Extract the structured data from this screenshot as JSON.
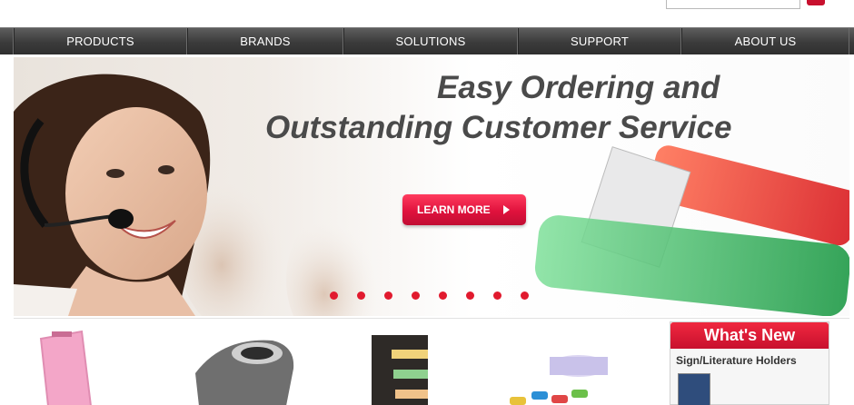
{
  "nav": {
    "items": [
      {
        "label": "PRODUCTS"
      },
      {
        "label": "BRANDS"
      },
      {
        "label": "SOLUTIONS"
      },
      {
        "label": "SUPPORT"
      },
      {
        "label": "ABOUT US"
      }
    ]
  },
  "search": {
    "value": ""
  },
  "hero": {
    "headline_line1": "Easy Ordering and",
    "headline_line2": "Outstanding Customer Service",
    "cta_label": "LEARN MORE",
    "slide_count": 8
  },
  "whats_new": {
    "title": "What's New",
    "item_title": "Sign/Literature Holders"
  },
  "colors": {
    "accent": "#e11a2e",
    "nav_bg": "#3b3b3b",
    "headline": "#4a4a4a"
  }
}
